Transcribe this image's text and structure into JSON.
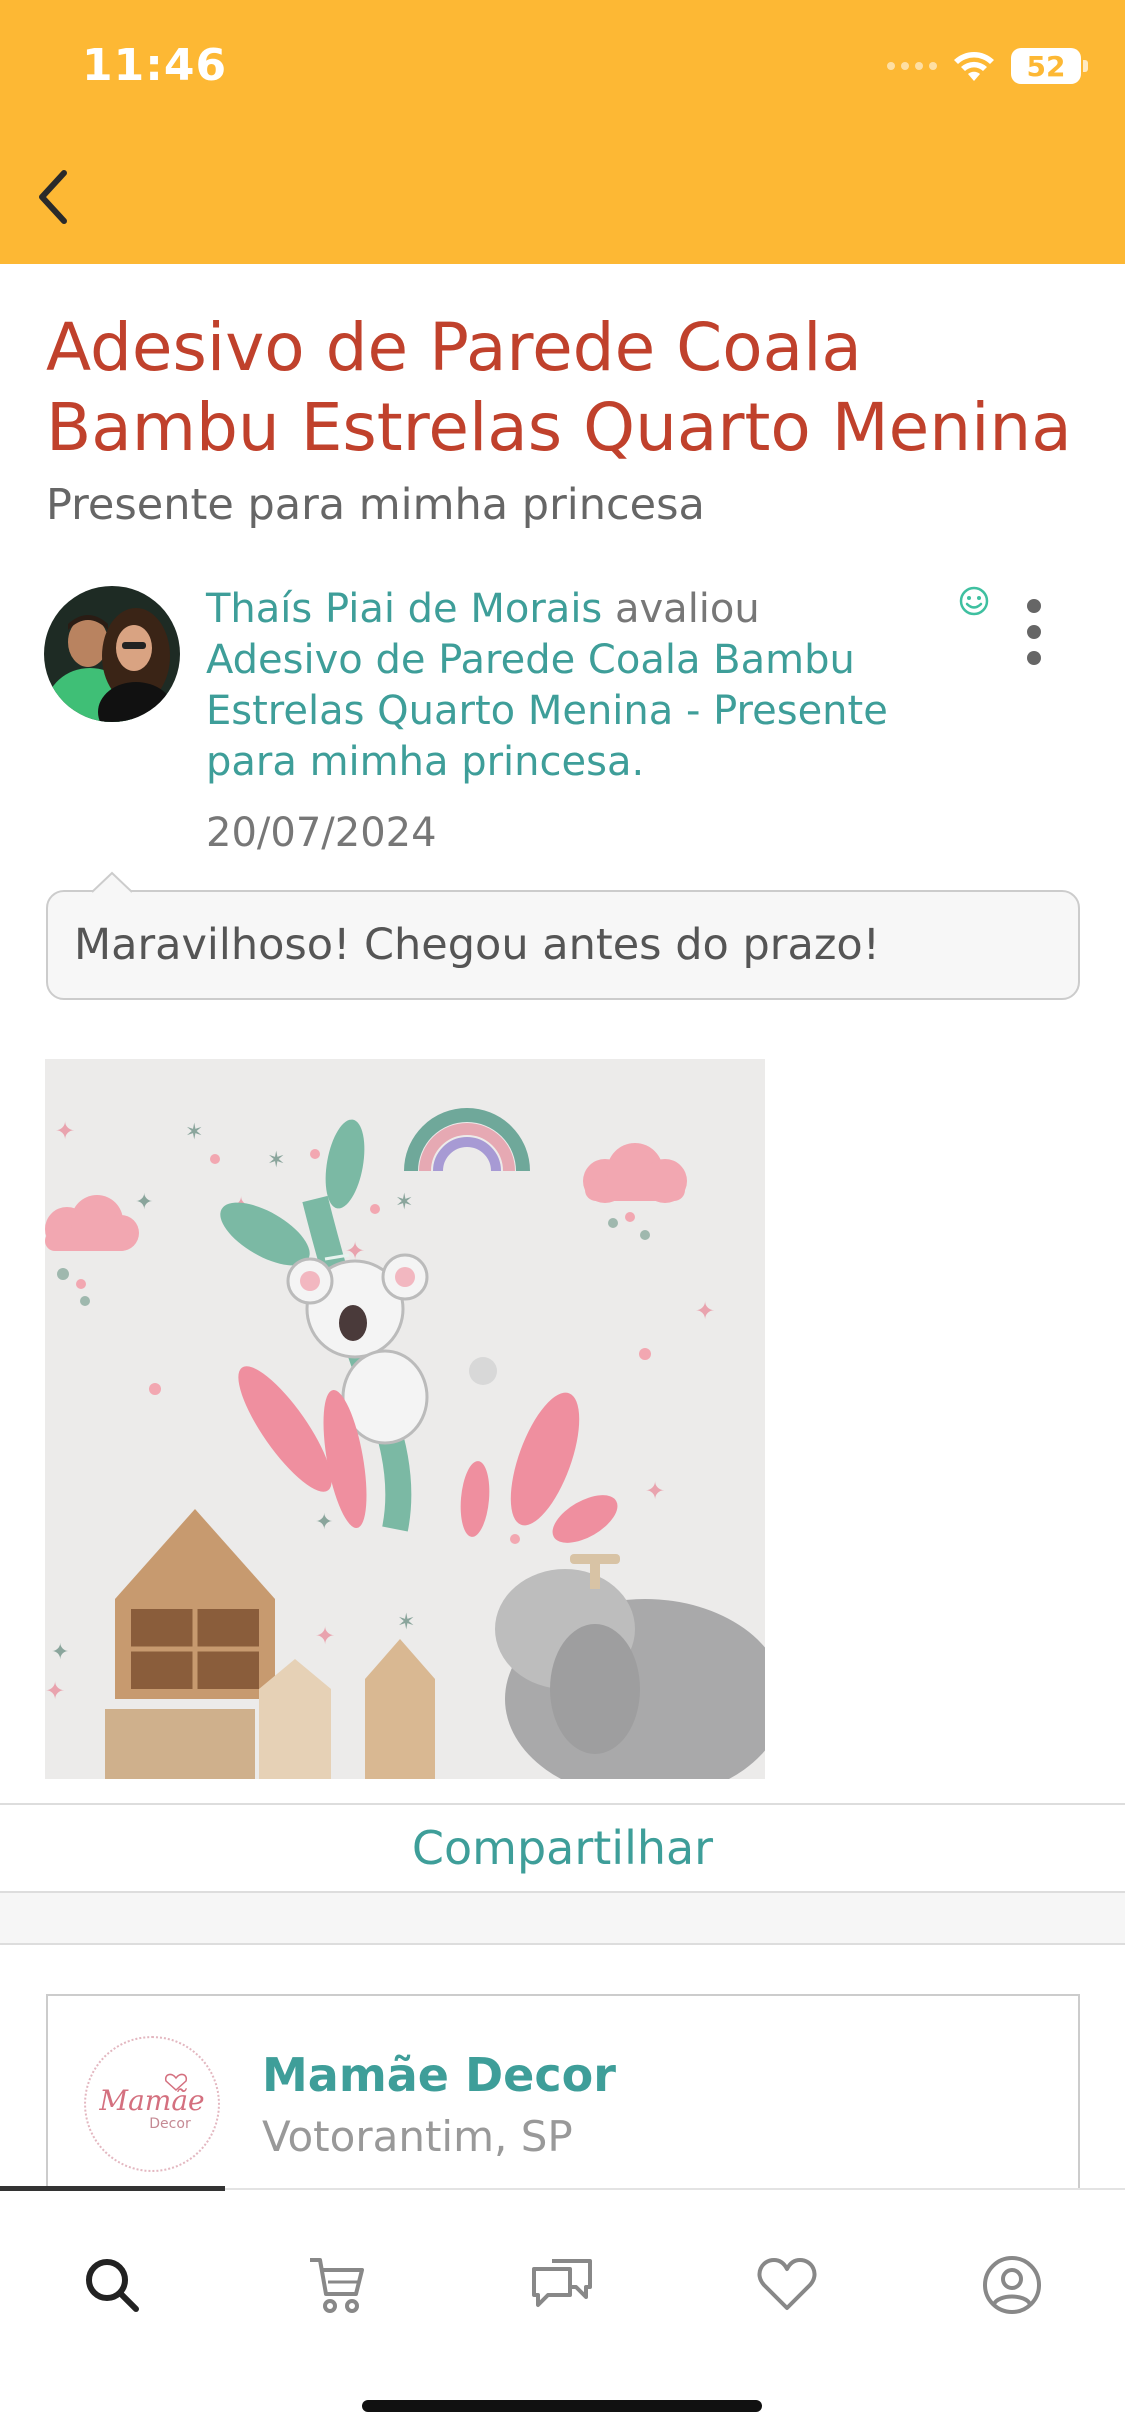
{
  "status_bar": {
    "time": "11:46",
    "battery": "52"
  },
  "product": {
    "title": "Adesivo de Parede Coala Bambu Estrelas Quarto Menina",
    "review_title": "Presente para mimha princesa"
  },
  "review": {
    "reviewer_name": "Thaís Piai de Morais",
    "action": " avaliou ",
    "reviewed_item": "Adesivo de Parede Coala Bambu Estrelas Quarto Menina - Presente para mimha princesa",
    "period": ".",
    "date": "20/07/2024",
    "comment": "Maravilhoso! Chegou antes do prazo!"
  },
  "share": {
    "label": "Compartilhar"
  },
  "store": {
    "name": "Mamãe Decor",
    "location": "Votorantim, SP",
    "logo_text_main": "Mamãe",
    "logo_text_sub": "Decor"
  },
  "tabs": [
    {
      "icon": "search-icon"
    },
    {
      "icon": "cart-icon"
    },
    {
      "icon": "chat-icon"
    },
    {
      "icon": "heart-icon"
    },
    {
      "icon": "profile-icon"
    }
  ],
  "colors": {
    "header": "#FDB834",
    "title": "#C0412C",
    "accent": "#3E9E99"
  }
}
